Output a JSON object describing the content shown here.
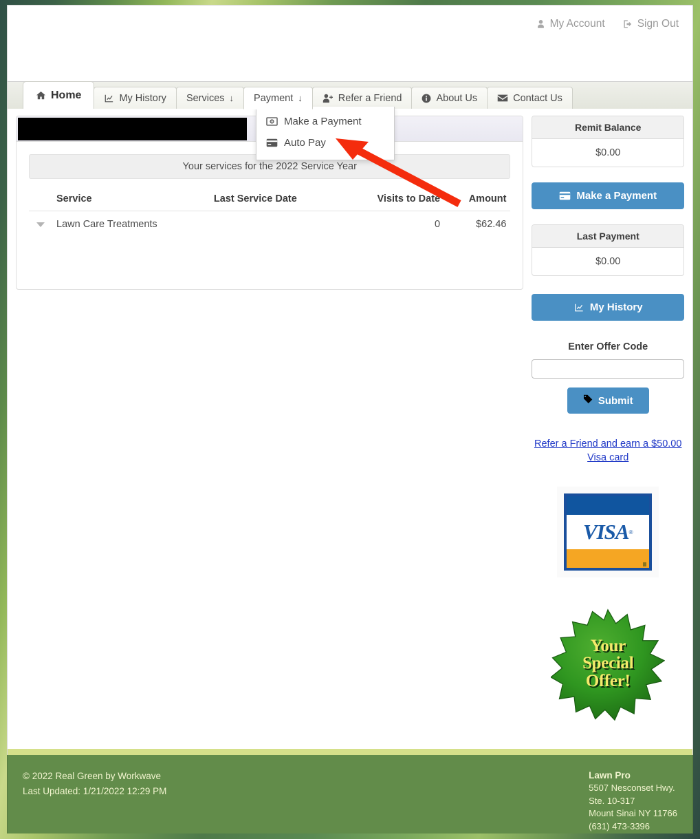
{
  "header": {
    "account_links": [
      {
        "label": "My Account",
        "icon": "user-icon"
      },
      {
        "label": "Sign Out",
        "icon": "sign-out-icon"
      }
    ]
  },
  "nav": {
    "tabs": [
      {
        "label": "Home",
        "icon": "home-icon",
        "active": true,
        "caret": false
      },
      {
        "label": "My History",
        "icon": "chart-line-icon",
        "active": false,
        "caret": false
      },
      {
        "label": "Services",
        "icon": null,
        "active": false,
        "caret": true
      },
      {
        "label": "Payment",
        "icon": null,
        "active": false,
        "caret": true,
        "open": true
      },
      {
        "label": "Refer a Friend",
        "icon": "user-plus-icon",
        "active": false,
        "caret": false
      },
      {
        "label": "About Us",
        "icon": "info-icon",
        "active": false,
        "caret": false
      },
      {
        "label": "Contact Us",
        "icon": "envelope-icon",
        "active": false,
        "caret": false
      }
    ],
    "caret_glyph": "↓"
  },
  "dropdown": {
    "open_for": "Payment",
    "items": [
      {
        "label": "Make a Payment",
        "icon": "money-bill-icon"
      },
      {
        "label": "Auto Pay",
        "icon": "credit-card-icon"
      }
    ]
  },
  "main": {
    "panel_header_redacted": true,
    "service_year_banner": "Your services for the 2022 Service Year",
    "table": {
      "columns": [
        "Service",
        "Last Service Date",
        "Visits to Date",
        "Amount"
      ],
      "rows": [
        {
          "service": "Lawn Care Treatments",
          "last_service_date": "",
          "visits_to_date": "0",
          "amount": "$62.46"
        }
      ]
    }
  },
  "sidebar": {
    "remit_balance": {
      "title": "Remit Balance",
      "value": "$0.00"
    },
    "make_payment_button": {
      "label": "Make a Payment",
      "icon": "credit-card-icon"
    },
    "last_payment": {
      "title": "Last Payment",
      "value": "$0.00"
    },
    "my_history_button": {
      "label": "My History",
      "icon": "chart-line-icon"
    },
    "offer_code": {
      "label": "Enter Offer Code",
      "value": "",
      "placeholder": "",
      "submit_label": "Submit",
      "submit_icon": "tag-icon"
    },
    "refer_link": "Refer a Friend and earn a $50.00 Visa card",
    "visa_image": {
      "alt": "VISA",
      "text": "VISA",
      "registered": "®"
    },
    "special_offer": {
      "line1": "Your",
      "line2": "Special",
      "line3": "Offer!"
    }
  },
  "footer": {
    "copyright": "© 2022 Real Green by Workwave",
    "last_updated": "Last Updated: 1/21/2022 12:29 PM",
    "company": {
      "name": "Lawn Pro",
      "address1": "5507 Nesconset Hwy.",
      "address2": "Ste. 10-317",
      "address3": "Mount Sinai NY 11766",
      "phone": "(631) 473-3396"
    }
  },
  "annotation": {
    "type": "red-arrow",
    "points_to": "Auto Pay",
    "color": "#f42c0d"
  },
  "colors": {
    "accent_blue": "#4a90c4",
    "footer_green": "#628c4a",
    "footer_stripe": "#d5e08a",
    "link_blue": "#1f38c7",
    "annotation_red": "#f42c0d"
  }
}
